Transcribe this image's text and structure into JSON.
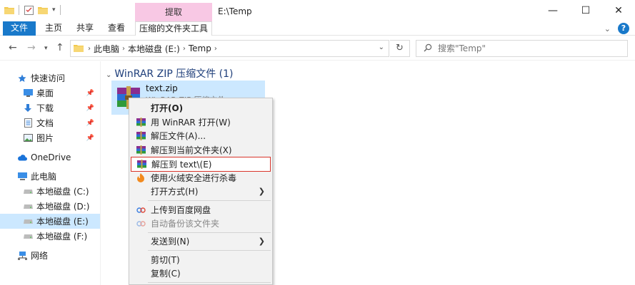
{
  "window": {
    "title": "E:\\Temp",
    "tool_tab_group": "提取",
    "minimize": "—",
    "maximize": "☐",
    "close": "✕"
  },
  "ribbon": {
    "tabs": [
      "文件",
      "主页",
      "共享",
      "查看",
      "压缩的文件夹工具"
    ],
    "help": "?"
  },
  "address": {
    "crumbs": [
      "此电脑",
      "本地磁盘 (E:)",
      "Temp"
    ],
    "search_placeholder": "搜索\"Temp\""
  },
  "sidebar": {
    "items": [
      {
        "label": "快速访问",
        "icon": "star-icon",
        "pinned": false
      },
      {
        "label": "桌面",
        "icon": "desktop-icon",
        "pinned": true
      },
      {
        "label": "下载",
        "icon": "download-icon",
        "pinned": true
      },
      {
        "label": "文档",
        "icon": "document-icon",
        "pinned": true
      },
      {
        "label": "图片",
        "icon": "picture-icon",
        "pinned": true
      },
      {
        "label": "OneDrive",
        "icon": "cloud-icon",
        "pinned": false
      },
      {
        "label": "此电脑",
        "icon": "computer-icon",
        "pinned": false
      },
      {
        "label": "本地磁盘 (C:)",
        "icon": "drive-icon",
        "pinned": false
      },
      {
        "label": "本地磁盘 (D:)",
        "icon": "drive-icon",
        "pinned": false
      },
      {
        "label": "本地磁盘 (E:)",
        "icon": "drive-icon",
        "pinned": false,
        "selected": true
      },
      {
        "label": "本地磁盘 (F:)",
        "icon": "drive-icon",
        "pinned": false
      },
      {
        "label": "网络",
        "icon": "network-icon",
        "pinned": false
      }
    ]
  },
  "main": {
    "group_header": "WinRAR ZIP 压缩文件 (1)",
    "file": {
      "name": "text.zip",
      "type": "WinRAR ZIP 压缩文件"
    }
  },
  "context_menu": {
    "items": [
      {
        "label": "打开(O)",
        "icon": "",
        "bold": true
      },
      {
        "label": "用 WinRAR 打开(W)",
        "icon": "winrar-icon"
      },
      {
        "label": "解压文件(A)...",
        "icon": "winrar-icon"
      },
      {
        "label": "解压到当前文件夹(X)",
        "icon": "winrar-icon"
      },
      {
        "label": "解压到 text\\(E)",
        "icon": "winrar-icon",
        "highlighted": true
      },
      {
        "label": "使用火绒安全进行杀毒",
        "icon": "huorong-icon"
      },
      {
        "label": "打开方式(H)",
        "icon": "",
        "submenu": true
      },
      {
        "label": "上传到百度网盘",
        "icon": "baidu-cloud-icon"
      },
      {
        "label": "自动备份该文件夹",
        "icon": "baidu-cloud-icon",
        "disabled": true
      },
      {
        "label": "发送到(N)",
        "icon": "",
        "submenu": true
      },
      {
        "label": "剪切(T)",
        "icon": ""
      },
      {
        "label": "复制(C)",
        "icon": ""
      }
    ]
  },
  "colors": {
    "accent": "#1979ca",
    "selection": "#cce8ff",
    "tool_tab": "#f8c8e4",
    "highlight_border": "#d9342b"
  }
}
